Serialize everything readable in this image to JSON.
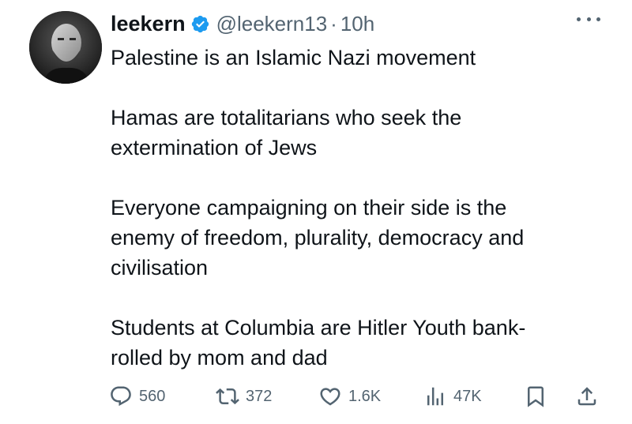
{
  "author": {
    "display_name": "leekern",
    "handle": "@leekern13",
    "separator": "·",
    "time": "10h"
  },
  "tweet": {
    "paragraphs": [
      "Palestine is an Islamic Nazi movement",
      "Hamas are totalitarians who seek the\nextermination of Jews",
      "Everyone campaigning on their side is the\nenemy of freedom, plurality, democracy and\ncivilisation",
      "Students at Columbia are Hitler Youth bank-\nrolled by mom and dad"
    ]
  },
  "actions": {
    "replies": "560",
    "reposts": "372",
    "likes": "1.6K",
    "views": "47K"
  },
  "colors": {
    "verified": "#1d9bf0",
    "secondary_text": "#536471",
    "primary_text": "#0f1419"
  },
  "icons": [
    "reply-icon",
    "repost-icon",
    "like-icon",
    "views-icon",
    "bookmark-icon",
    "share-icon",
    "verified-badge-icon",
    "more-icon"
  ]
}
